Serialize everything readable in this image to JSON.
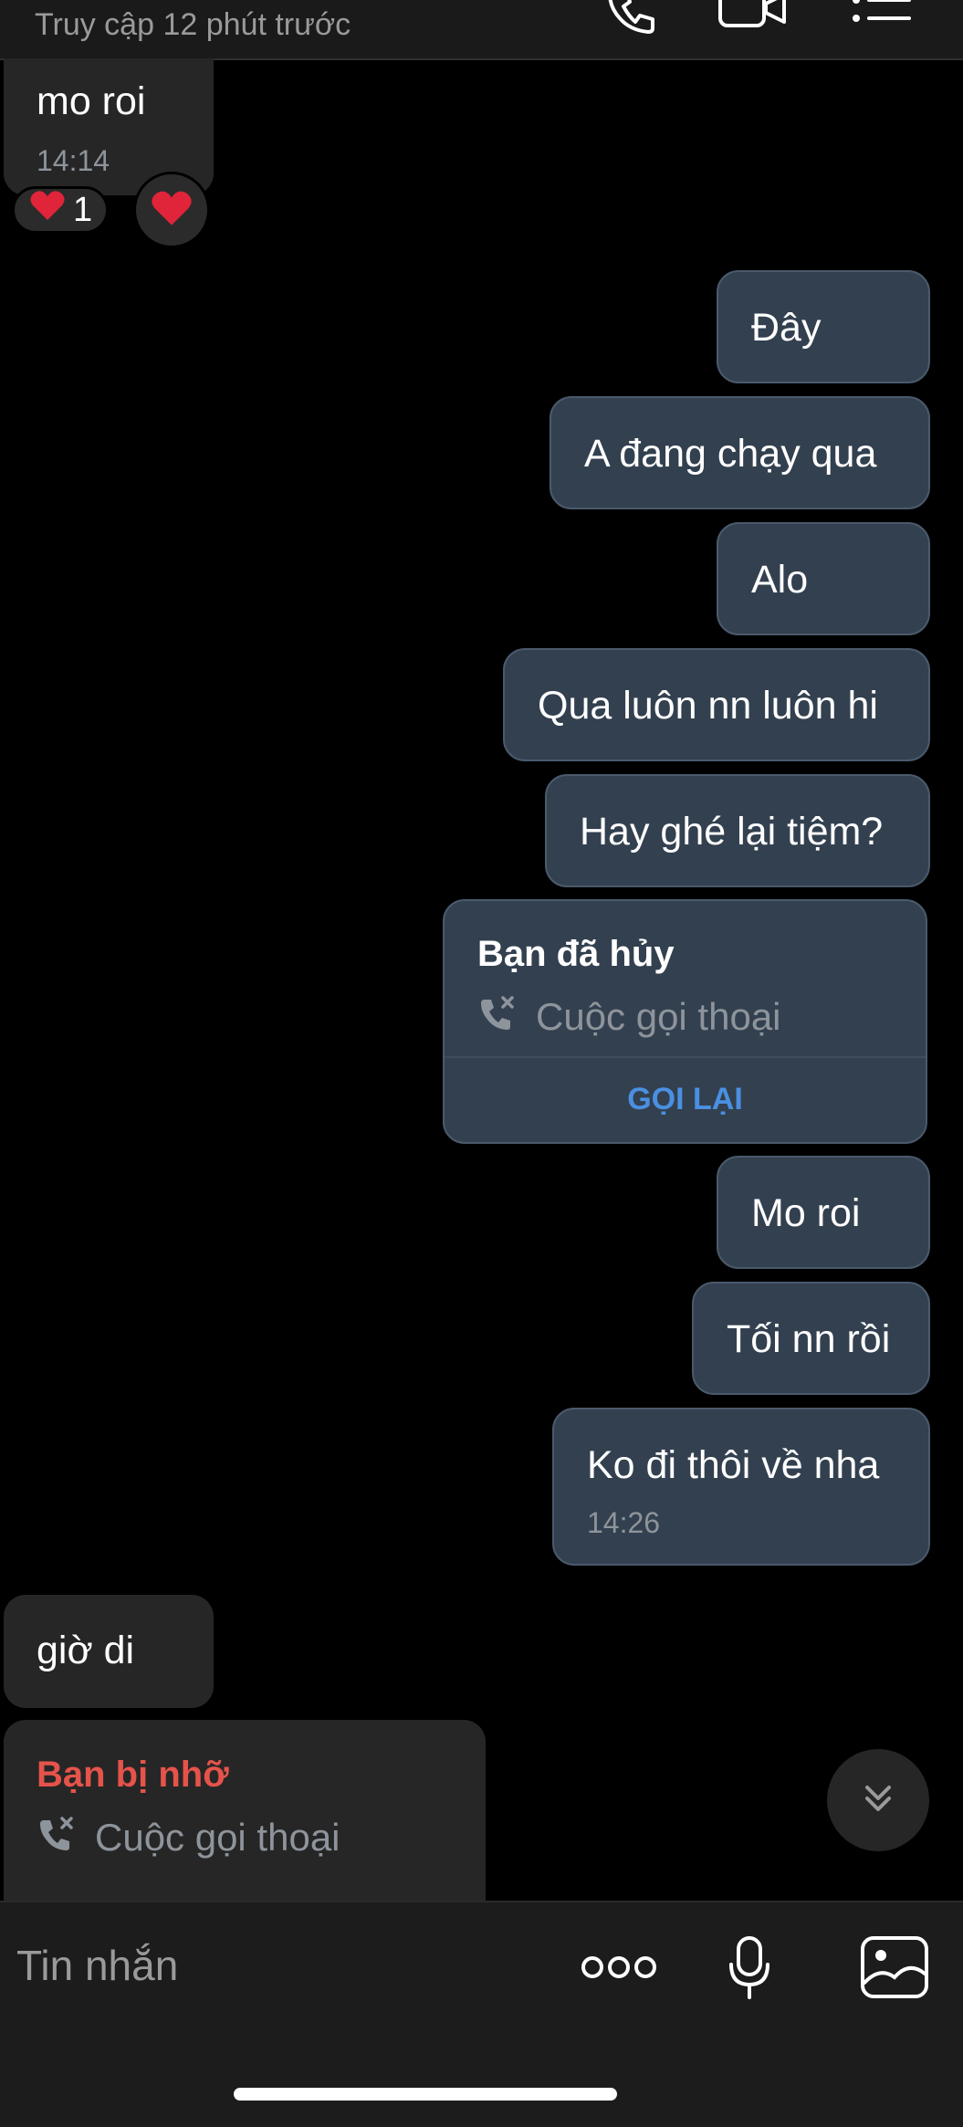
{
  "header": {
    "status": "Truy cập 12 phút trước",
    "icons": [
      "phone-icon",
      "video-icon",
      "list-icon"
    ]
  },
  "messages": [
    {
      "side": "in",
      "text": "mo roi",
      "time": "14:14",
      "reactions": {
        "summary_icon": "heart",
        "count": "1",
        "button_icon": "heart"
      }
    },
    {
      "side": "out",
      "text": "Đây"
    },
    {
      "side": "out",
      "text": "A đang chạy qua"
    },
    {
      "side": "out",
      "text": "Alo"
    },
    {
      "side": "out",
      "text": "Qua luôn nn luôn hi"
    },
    {
      "side": "out",
      "text": "Hay ghé lại tiệm?"
    },
    {
      "side": "out",
      "type": "call",
      "title": "Bạn đã hủy",
      "subtitle": "Cuộc gọi thoại",
      "action": "GỌI LẠI"
    },
    {
      "side": "out",
      "text": "Mo roi"
    },
    {
      "side": "out",
      "text": "Tối nn rồi"
    },
    {
      "side": "out",
      "text": "Ko đi thôi về nha",
      "time": "14:26"
    },
    {
      "side": "in",
      "text": "giờ di"
    },
    {
      "side": "in",
      "type": "call",
      "title": "Bạn bị nhỡ",
      "subtitle": "Cuộc gọi thoại"
    }
  ],
  "composer": {
    "placeholder": "Tin nhắn",
    "icons": [
      "more-icon",
      "microphone-icon",
      "image-icon"
    ]
  },
  "colors": {
    "outgoing_bubble": "#33404f",
    "incoming_bubble": "#262626",
    "link_blue": "#4a90e2",
    "missed_red": "#e5534b"
  }
}
